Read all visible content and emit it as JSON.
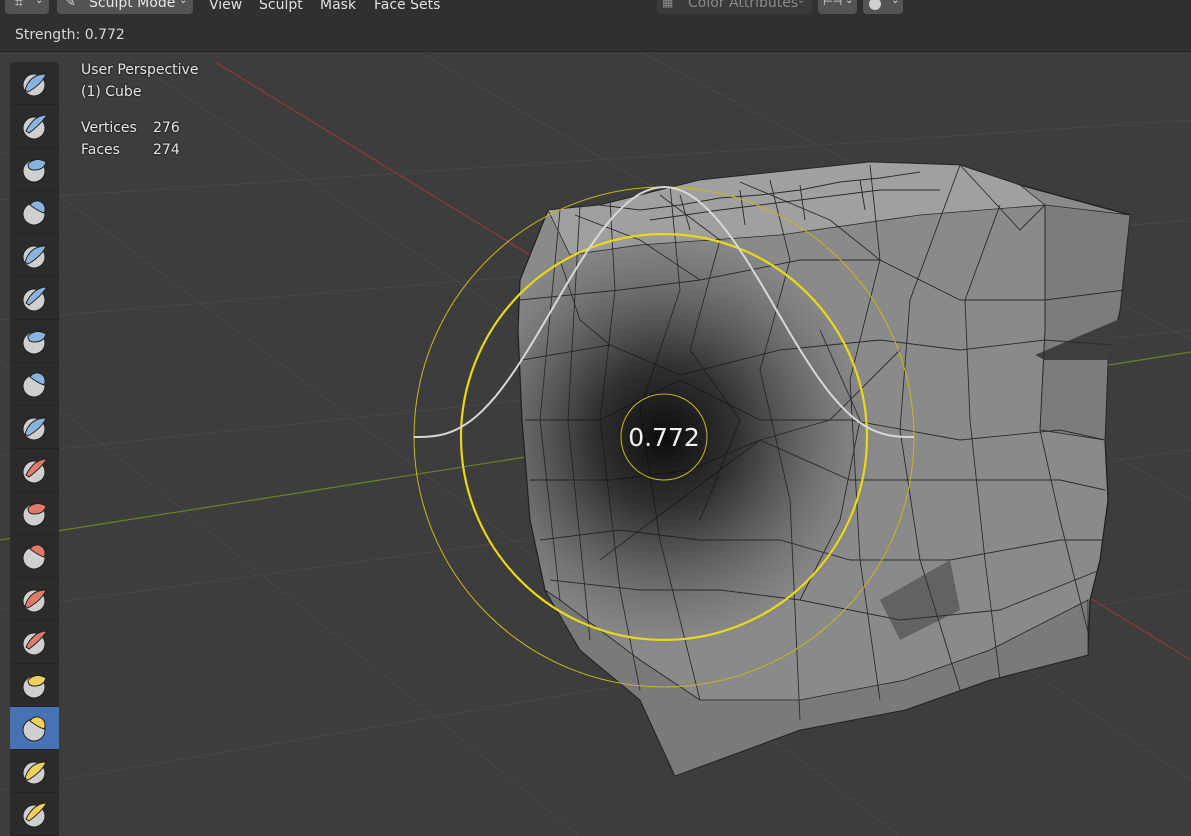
{
  "header": {
    "mode_label": "Sculpt Mode",
    "menus": [
      "View",
      "Sculpt",
      "Mask",
      "Face Sets"
    ],
    "color_attributes_label": "Color Attributes"
  },
  "strength_bar": {
    "text": "Strength: 0.772"
  },
  "overlay": {
    "perspective": "User Perspective",
    "object": "(1) Cube",
    "stats": [
      {
        "label": "Vertices",
        "value": "276"
      },
      {
        "label": "Faces",
        "value": "274"
      }
    ]
  },
  "brush_cursor": {
    "strength_value": "0.772",
    "strength": 0.772
  },
  "toolbar": {
    "active_index": 15,
    "tools": [
      {
        "icon": "draw-brush-icon",
        "color": "#8ab4e0"
      },
      {
        "icon": "draw-sharp-brush-icon",
        "color": "#8ab4e0"
      },
      {
        "icon": "clay-brush-icon",
        "color": "#8ab4e0"
      },
      {
        "icon": "clay-strips-brush-icon",
        "color": "#8ab4e0"
      },
      {
        "icon": "clay-thumb-brush-icon",
        "color": "#8ab4e0"
      },
      {
        "icon": "layer-brush-icon",
        "color": "#8ab4e0"
      },
      {
        "icon": "inflate-brush-icon",
        "color": "#8ab4e0"
      },
      {
        "icon": "blob-brush-icon",
        "color": "#8ab4e0"
      },
      {
        "icon": "crease-brush-icon",
        "color": "#8ab4e0"
      },
      {
        "icon": "smooth-brush-icon",
        "color": "#e07a6a"
      },
      {
        "icon": "flatten-brush-icon",
        "color": "#e07a6a"
      },
      {
        "icon": "fill-brush-icon",
        "color": "#e07a6a"
      },
      {
        "icon": "scrape-brush-icon",
        "color": "#e07a6a"
      },
      {
        "icon": "multiplane-scrape-brush-icon",
        "color": "#e07a6a"
      },
      {
        "icon": "pinch-brush-icon",
        "color": "#f2d05a"
      },
      {
        "icon": "grab-brush-icon",
        "color": "#f2d05a"
      },
      {
        "icon": "elastic-deform-brush-icon",
        "color": "#f2d05a"
      },
      {
        "icon": "snake-hook-brush-icon",
        "color": "#f2d05a"
      }
    ]
  },
  "colors": {
    "accent_active": "#4772b3",
    "brush_ring": "#e8d81a",
    "x_axis": "#9b3b3b",
    "y_axis": "#6f8f2d"
  }
}
